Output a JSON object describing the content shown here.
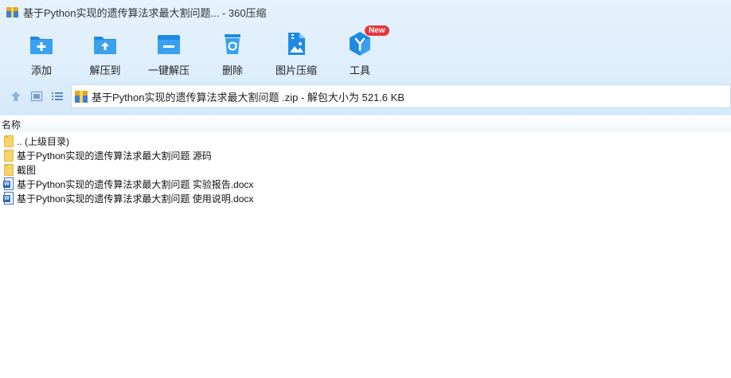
{
  "window": {
    "title": "基于Python实现的遗传算法求最大割问题... - 360压缩"
  },
  "toolbar": {
    "items": [
      {
        "label": "添加",
        "icon": "add-icon"
      },
      {
        "label": "解压到",
        "icon": "extract-to-icon"
      },
      {
        "label": "一键解压",
        "icon": "one-click-extract-icon"
      },
      {
        "label": "删除",
        "icon": "delete-icon"
      },
      {
        "label": "图片压缩",
        "icon": "image-compress-icon"
      },
      {
        "label": "工具",
        "icon": "tools-icon",
        "badge": "New"
      }
    ]
  },
  "navigation": {
    "path_text": "基于Python实现的遗传算法求最大割问题 .zip - 解包大小为 521.6 KB"
  },
  "list": {
    "column_name": "名称",
    "items": [
      {
        "name": ".. (上级目录)",
        "type": "folder"
      },
      {
        "name": "基于Python实现的遗传算法求最大割问题 源码",
        "type": "folder"
      },
      {
        "name": "截图",
        "type": "folder"
      },
      {
        "name": "基于Python实现的遗传算法求最大割问题 实验报告.docx",
        "type": "docx"
      },
      {
        "name": "基于Python实现的遗传算法求最大割问题 使用说明.docx",
        "type": "docx"
      }
    ]
  },
  "colors": {
    "accent": "#1e8ae6",
    "header_bg": "#deeefc",
    "badge": "#e8353b"
  }
}
